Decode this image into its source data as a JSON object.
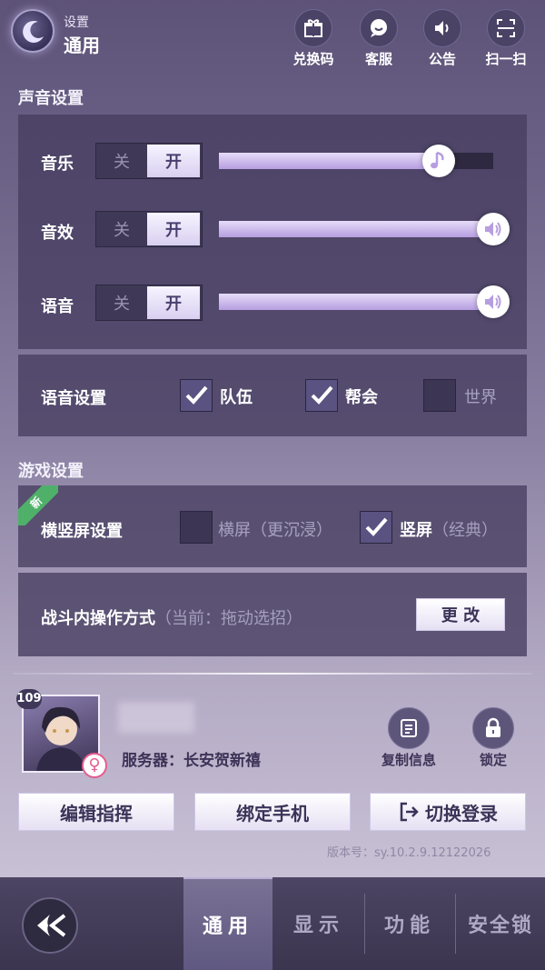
{
  "header": {
    "breadcrumb_parent": "设置",
    "page_title": "通用",
    "actions": [
      {
        "label": "兑换码",
        "icon": "gift-icon"
      },
      {
        "label": "客服",
        "icon": "chat-icon"
      },
      {
        "label": "公告",
        "icon": "speaker-icon"
      },
      {
        "label": "扫一扫",
        "icon": "scan-icon"
      }
    ]
  },
  "sound": {
    "section_title": "声音设置",
    "toggle_off": "关",
    "toggle_on": "开",
    "rows": [
      {
        "label": "音乐",
        "state": "on",
        "level": 0.8,
        "knob_icon": "music-note-icon"
      },
      {
        "label": "音效",
        "state": "on",
        "level": 1.0,
        "knob_icon": "volume-icon"
      },
      {
        "label": "语音",
        "state": "on",
        "level": 1.0,
        "knob_icon": "volume-icon"
      }
    ],
    "voice": {
      "label": "语音设置",
      "options": [
        {
          "label": "队伍",
          "checked": true
        },
        {
          "label": "帮会",
          "checked": true
        },
        {
          "label": "世界",
          "checked": false
        }
      ]
    }
  },
  "game": {
    "section_title": "游戏设置",
    "new_badge": "新",
    "orientation": {
      "label": "横竖屏设置",
      "options": [
        {
          "label": "横屏",
          "hint": "（更沉浸）",
          "checked": false
        },
        {
          "label": "竖屏",
          "hint": "（经典）",
          "checked": true
        }
      ]
    },
    "combat": {
      "label": "战斗内操作方式",
      "hint": "（当前：拖动选招）",
      "button": "更 改"
    }
  },
  "profile": {
    "level": "109",
    "gender_symbol": "♀",
    "server": "服务器：长安贺新禧",
    "actions": [
      {
        "label": "复制信息",
        "icon": "copy-info-icon"
      },
      {
        "label": "锁定",
        "icon": "lock-icon"
      }
    ],
    "buttons": [
      "编辑指挥",
      "绑定手机",
      "切换登录"
    ],
    "version": "版本号：sy.10.2.9.12122026"
  },
  "tabs": [
    {
      "label": "通用",
      "active": true
    },
    {
      "label": "显示",
      "active": false
    },
    {
      "label": "功能",
      "active": false
    },
    {
      "label": "安全锁",
      "active": false
    }
  ],
  "colors": {
    "accent_fill": "#b69ee0",
    "panel": "#463e60",
    "gender": "#e45d8f",
    "new_badge": "#4fb06a"
  }
}
